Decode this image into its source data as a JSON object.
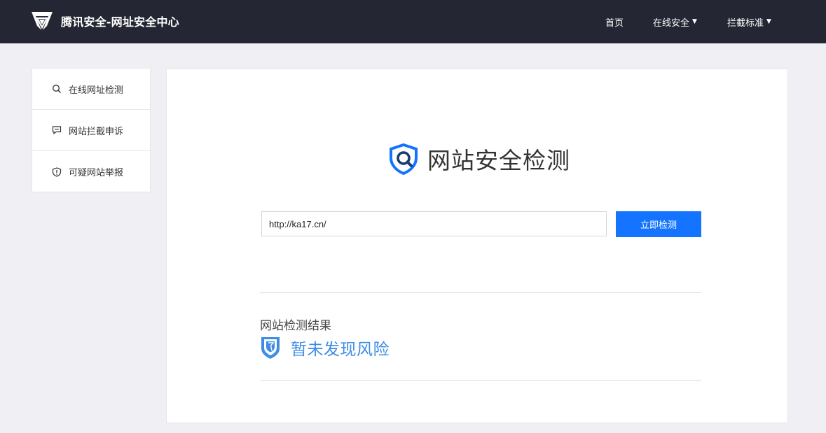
{
  "header": {
    "brand_title": "腾讯安全-网址安全中心",
    "nav": {
      "home": "首页",
      "online_security": "在线安全",
      "block_standard": "拦截标准"
    }
  },
  "sidebar": {
    "items": [
      {
        "label": "在线网址检测",
        "icon": "search-icon"
      },
      {
        "label": "网站拦截申诉",
        "icon": "chat-icon"
      },
      {
        "label": "可疑网站举报",
        "icon": "shield-alert-icon"
      }
    ]
  },
  "main": {
    "title": "网站安全检测",
    "url_value": "http://ka17.cn/",
    "check_button": "立即检测",
    "result_heading": "网站检测结果",
    "result_text": "暂未发现风险"
  },
  "colors": {
    "topbar": "#242733",
    "accent": "#1474ff",
    "result_blue": "#3d8ce6",
    "background": "#f0f0f4"
  }
}
